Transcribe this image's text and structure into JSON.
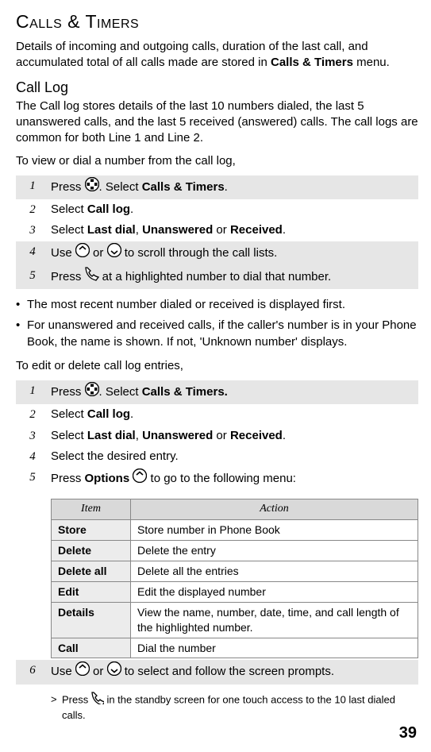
{
  "heading": "Calls & Timers",
  "intro": {
    "p1a": "Details of incoming and outgoing calls, duration of the last call, and accumulated total of all calls made are stored in  ",
    "p1b": "Calls & Timers",
    "p1c": " menu."
  },
  "calllog": {
    "title": "Call Log",
    "desc": "The Call log stores details of the last 10 numbers dialed, the last 5 unanswered calls, and the last 5 received (answered) calls. The call logs are common for both Line 1 and Line 2.",
    "lead1": "To view or dial a number from the call log,",
    "steps1": {
      "s1a": "Press ",
      "s1b": ". Select  ",
      "s1c": "Calls & Timers",
      "s1d": ".",
      "s2a": "Select  ",
      "s2b": "Call log",
      "s2c": ".",
      "s3a": "Select  ",
      "s3b": "Last dial",
      "s3c": ", ",
      "s3d": "Unanswered",
      "s3e": " or ",
      "s3f": "Received",
      "s3g": ".",
      "s4a": "Use ",
      "s4b": " or ",
      "s4c": " to scroll through the call lists.",
      "s5a": "Press ",
      "s5b": " at a highlighted number to dial that number."
    },
    "notes": {
      "n1": "The most recent number dialed or received is displayed first.",
      "n2": "For unanswered and received calls, if the caller's number is in your Phone Book, the name is shown. If not, 'Unknown number' displays."
    },
    "lead2": "To edit or delete call log entries,",
    "steps2": {
      "s1a": "Press ",
      "s1b": ". Select ",
      "s1c": "Calls & Timers.",
      "s2a": "Select ",
      "s2b": "Call log",
      "s2c": ".",
      "s3a": "Select  ",
      "s3b": "Last dial",
      "s3c": ", ",
      "s3d": "Unanswered",
      "s3e": " or ",
      "s3f": "Received",
      "s3g": ".",
      "s4": "Select the desired entry.",
      "s5a": "Press  ",
      "s5b": "Options",
      "s5c": " to go to the following menu:",
      "s6a": "Use ",
      "s6b": " or ",
      "s6c": " to select and follow the screen prompts."
    },
    "options_table": {
      "head_item": "Item",
      "head_action": "Action",
      "rows": [
        {
          "item": "Store",
          "action": "Store number in Phone Book"
        },
        {
          "item": "Delete",
          "action": "Delete the entry"
        },
        {
          "item": "Delete all",
          "action": "Delete all the entries"
        },
        {
          "item": "Edit",
          "action": "Edit the displayed number"
        },
        {
          "item": "Details",
          "action": "View the name, number, date, time, and call length of the highlighted number."
        },
        {
          "item": "Call",
          "action": "Dial the number"
        }
      ]
    },
    "tip": {
      "a": "Press ",
      "b": " in the standby screen for one touch access to the 10 last dialed calls."
    }
  },
  "page_number": "39",
  "nums": {
    "n1": "1",
    "n2": "2",
    "n3": "3",
    "n4": "4",
    "n5": "5",
    "n6": "6"
  },
  "glyphs": {
    "bullet": "•",
    "gt": ">"
  }
}
